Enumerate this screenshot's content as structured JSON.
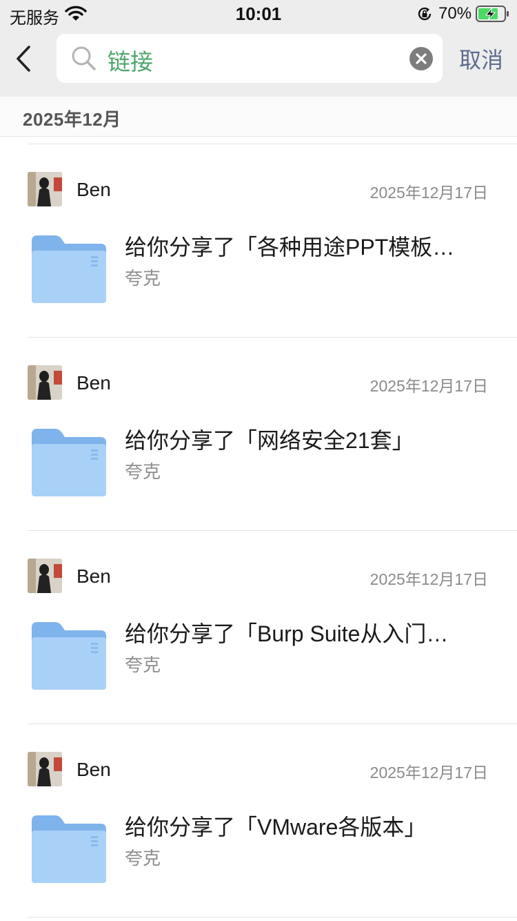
{
  "status_bar": {
    "carrier": "无服务",
    "time": "10:01",
    "battery": "70%"
  },
  "search": {
    "query": "链接",
    "cancel_label": "取消"
  },
  "section": {
    "month": "2025年12月"
  },
  "results": [
    {
      "sender": "Ben",
      "date": "2025年12月17日",
      "title": "给你分享了「各种用途PPT模板…",
      "source": "夸克"
    },
    {
      "sender": "Ben",
      "date": "2025年12月17日",
      "title": "给你分享了「网络安全21套」",
      "source": "夸克"
    },
    {
      "sender": "Ben",
      "date": "2025年12月17日",
      "title": "给你分享了「Burp Suite从入门…",
      "source": "夸克"
    },
    {
      "sender": "Ben",
      "date": "2025年12月17日",
      "title": "给你分享了「VMware各版本」",
      "source": "夸克"
    }
  ],
  "colors": {
    "query_green": "#4ea66a",
    "cancel_blue": "#5c6b8f",
    "folder_blue": "#8fc0f2"
  },
  "icons": [
    "wifi-icon",
    "rotation-lock-icon",
    "battery-charging-icon",
    "back-chevron-icon",
    "search-icon",
    "clear-icon",
    "folder-icon"
  ]
}
